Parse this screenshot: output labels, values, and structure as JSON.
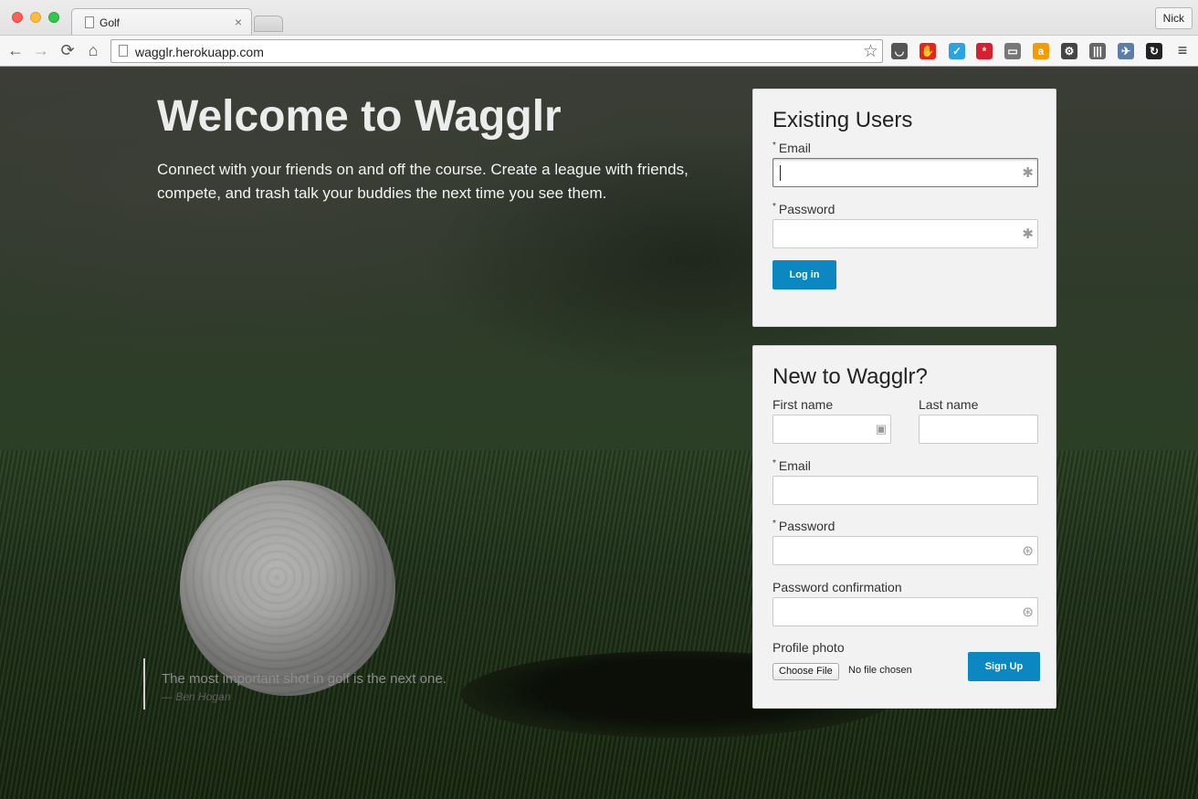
{
  "browser": {
    "tab_title": "Golf",
    "tab_close": "×",
    "profile_name": "Nick",
    "url": "wagglr.herokuapp.com",
    "nav": {
      "back": "←",
      "forward": "→",
      "reload": "⟳",
      "home": "⌂",
      "star": "☆",
      "menu": "≡"
    },
    "extensions": [
      {
        "name": "pocket-icon",
        "glyph": "◡",
        "color": "#555555"
      },
      {
        "name": "adblock-icon",
        "glyph": "✋",
        "color": "#e3261b"
      },
      {
        "name": "todo-check-icon",
        "glyph": "✓",
        "color": "#2ba3e0"
      },
      {
        "name": "lastpass-icon",
        "glyph": "*",
        "color": "#d7202f"
      },
      {
        "name": "cast-icon",
        "glyph": "▭",
        "color": "#777777"
      },
      {
        "name": "amazon-icon",
        "glyph": "a",
        "color": "#f49b00"
      },
      {
        "name": "settings-gear-icon",
        "glyph": "⚙",
        "color": "#444444"
      },
      {
        "name": "columns-icon",
        "glyph": "|||",
        "color": "#666666"
      },
      {
        "name": "satellite-icon",
        "glyph": "✈",
        "color": "#5a7ea8"
      },
      {
        "name": "sync-icon",
        "glyph": "↻",
        "color": "#222222"
      }
    ]
  },
  "hero": {
    "title": "Welcome to Wagglr",
    "subtitle": "Connect with your friends on and off the course. Create a league with friends, compete, and trash talk your buddies the next time you see them."
  },
  "quote": {
    "text": "The most important shot in golf is the next one.",
    "author": "— Ben Hogan"
  },
  "login": {
    "heading": "Existing Users",
    "email_label": "Email",
    "password_label": "Password",
    "required_mark": "*",
    "submit_label": "Log in"
  },
  "signup": {
    "heading": "New to Wagglr?",
    "first_name_label": "First name",
    "last_name_label": "Last name",
    "email_label": "Email",
    "password_label": "Password",
    "password_confirmation_label": "Password confirmation",
    "profile_photo_label": "Profile photo",
    "choose_file_label": "Choose File",
    "no_file_text": "No file chosen",
    "submit_label": "Sign Up",
    "required_mark": "*"
  },
  "icons": {
    "lastpass_field": "✱",
    "contact_card": "▣",
    "password_key": "⊛"
  },
  "colors": {
    "accent": "#0b88c2",
    "panel_bg": "#f2f2f2"
  }
}
